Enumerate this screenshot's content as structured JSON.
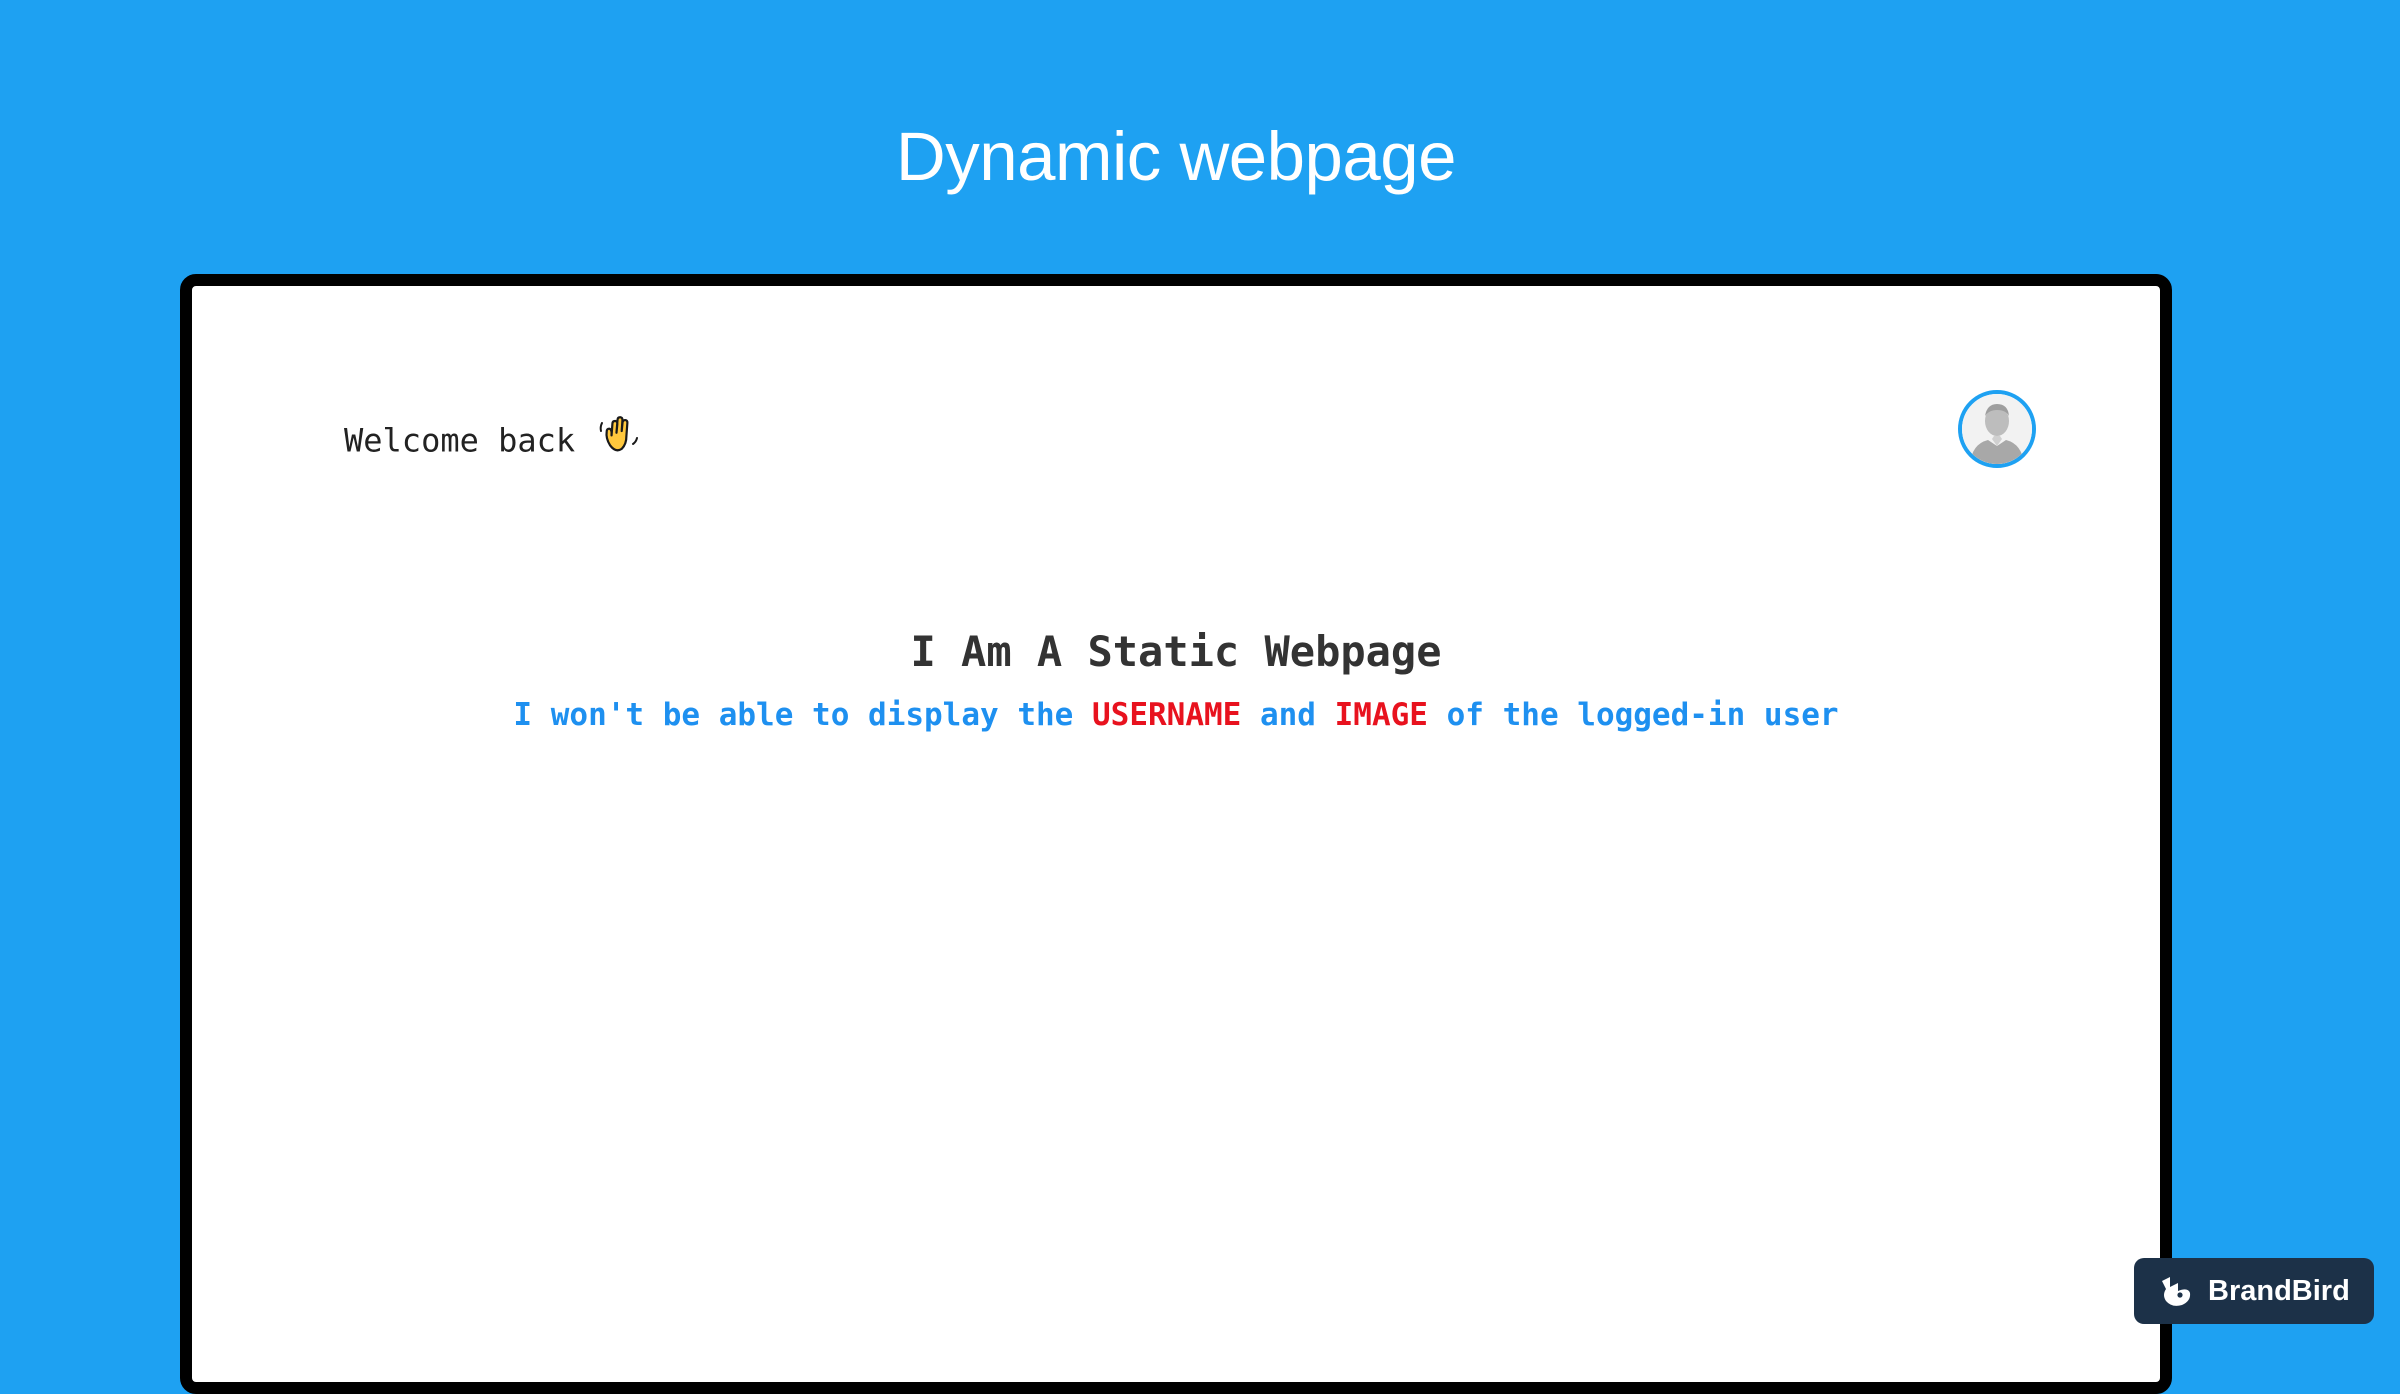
{
  "page": {
    "title": "Dynamic webpage"
  },
  "webpage": {
    "welcome_text": "Welcome back",
    "welcome_emoji": "waving-hand-icon",
    "avatar_icon": "default-user-avatar",
    "heading": "I Am A Static Webpage",
    "subtitle": {
      "part1": "I won't be able to display the ",
      "highlight1": "USERNAME",
      "part2": " and ",
      "highlight2": "IMAGE",
      "part3": " of the logged-in user"
    }
  },
  "badge": {
    "label": "BrandBird",
    "icon": "brandbird-logo-icon"
  },
  "colors": {
    "background": "#1ea1f2",
    "frame_border": "#000000",
    "subtitle_blue": "#1e90f0",
    "highlight_red": "#e8121e",
    "badge_bg": "#1c3148"
  }
}
